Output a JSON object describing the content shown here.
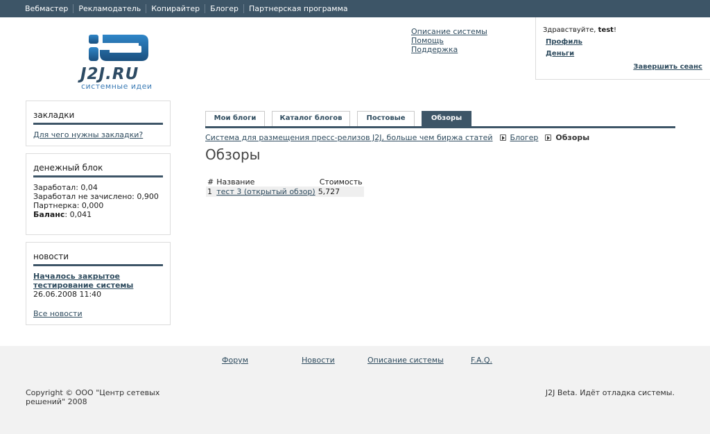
{
  "topnav": [
    "Вебмастер",
    "Рекламодатель",
    "Копирайтер",
    "Блогер",
    "Партнерская программа"
  ],
  "logo": {
    "brand": "J2J.RU",
    "tagline": "системные идеи",
    "colors": {
      "dark": "#2d4b64",
      "light": "#3b7bb5"
    }
  },
  "header_links": [
    "Описание системы",
    "Помощь",
    "Поддержка"
  ],
  "user": {
    "greeting": "Здравствуйте, ",
    "name": "test",
    "exclaim": "!",
    "profile": "Профиль",
    "money": "Деньги",
    "logout": "Завершить сеанс"
  },
  "bookmarks": {
    "title": "закладки",
    "link": "Для чего нужны закладки?"
  },
  "money": {
    "title": "денежный блок",
    "earned": "Заработал: 0,04",
    "pending": "Заработал не зачислено: 0,900",
    "partner": "Партнерка: 0,000",
    "balance_label": "Баланс",
    "balance_value": ": 0,041"
  },
  "news": {
    "title": "новости",
    "item": "Началось закрытое тестирование системы",
    "date": "26.06.2008 11:40",
    "all": "Все новости"
  },
  "tabs": [
    "Мои блоги",
    "Каталог блогов",
    "Постовые",
    "Обзоры"
  ],
  "breadcrumb": {
    "root": "Система для размещения пресс-релизов J2J, больше чем биржа статей",
    "section": "Блогер",
    "current": "Обзоры"
  },
  "page_title": "Обзоры",
  "table": {
    "headers": [
      "#",
      "Название",
      "Стоимость"
    ],
    "rows": [
      {
        "num": "1",
        "name": "тест 3 (открытый обзор)",
        "price": "5,727"
      }
    ]
  },
  "footer": {
    "links": [
      "Форум",
      "Новости",
      "Описание системы",
      "F.A.Q."
    ],
    "copyright": "Copyright © ООО \"Центр сетевых решений\" 2008",
    "status": "J2J Beta. Идёт отладка системы."
  },
  "colors": {
    "topbar": "#3d5567",
    "link": "#2e4b5e",
    "footer_bg": "#f2f2f2"
  }
}
